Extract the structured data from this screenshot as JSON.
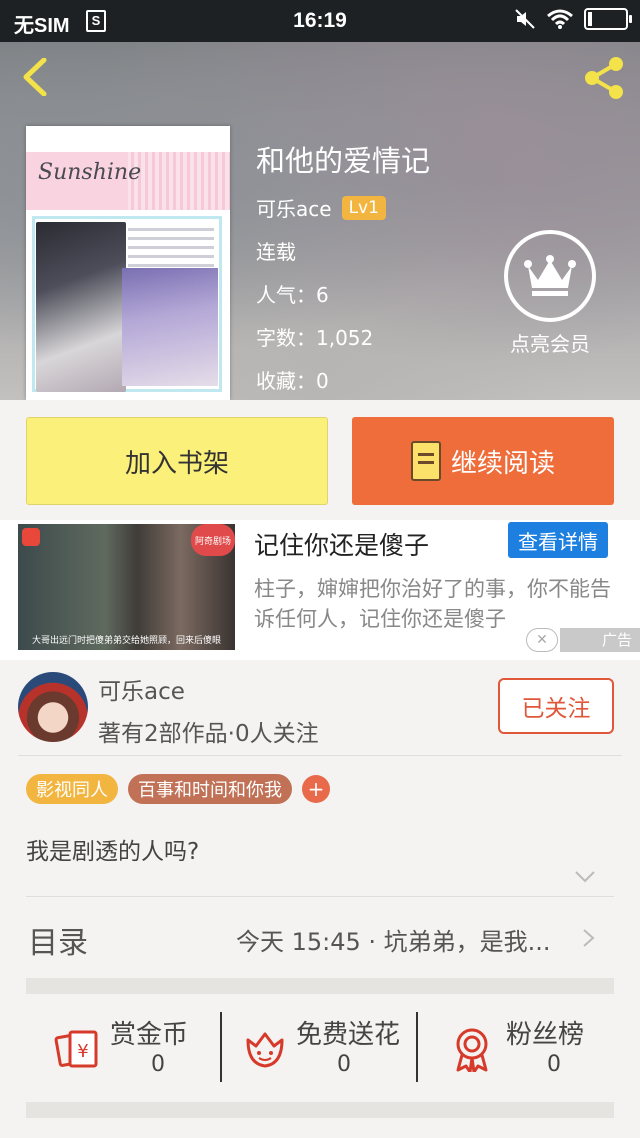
{
  "status": {
    "carrier": "无SIM",
    "sim_badge": "S",
    "time": "16:19"
  },
  "book": {
    "title": "和他的爱情记",
    "author": "可乐ace",
    "level": "Lv1",
    "state": "连载",
    "popularity": "人气：6",
    "word_count": "字数：1,052",
    "favorites": "收藏：0",
    "cover_text": "Sunshine"
  },
  "vip": {
    "label": "点亮会员"
  },
  "buttons": {
    "shelf": "加入书架",
    "read": "继续阅读"
  },
  "ad": {
    "title": "记住你还是傻子",
    "detail_btn": "查看详情",
    "desc": "柱子，婶婶把你治好了的事，你不能告诉任何人，记住你还是傻子",
    "caption": "大哥出远门时把傻弟弟交给她照顾，回来后傻眼",
    "corner_tag": "阿奇剧场",
    "close": "✕",
    "label": "广告"
  },
  "author_card": {
    "name": "可乐ace",
    "sub": "著有2部作品·0人关注",
    "follow": "已关注"
  },
  "tags": [
    "影视同人",
    "百事和时间和你我"
  ],
  "tag_plus": "+",
  "intro": "我是剧透的人吗?",
  "toc": {
    "label": "目录",
    "last_update": "今天 15:45 · 坑弟弟，是我..."
  },
  "actions": [
    {
      "label": "赏金币",
      "count": "0",
      "icon": "coin-envelope-icon"
    },
    {
      "label": "免费送花",
      "count": "0",
      "icon": "flower-icon"
    },
    {
      "label": "粉丝榜",
      "count": "0",
      "icon": "medal-icon"
    }
  ],
  "colors": {
    "accent_orange": "#ee6d3b",
    "shelf_yellow": "#fbf07a",
    "icon_red": "#d63a2a",
    "lv_badge": "#f2b540"
  }
}
